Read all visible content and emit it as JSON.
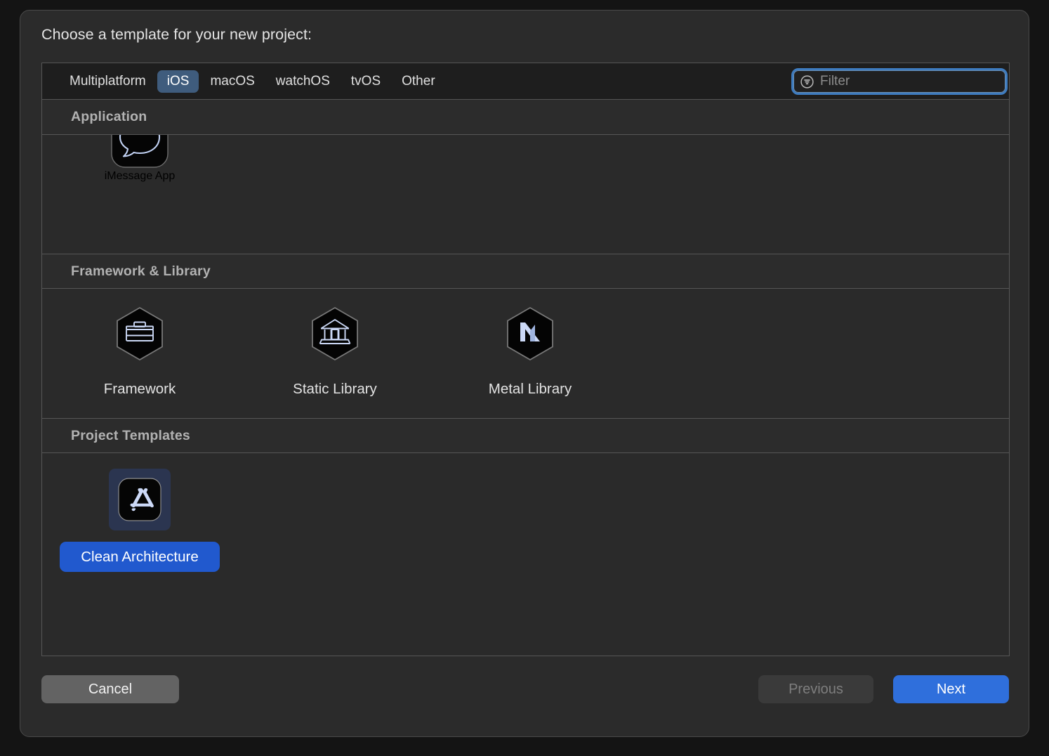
{
  "dialog": {
    "title": "Choose a template for your new project:"
  },
  "tabs": [
    {
      "label": "Multiplatform",
      "selected": false
    },
    {
      "label": "iOS",
      "selected": true
    },
    {
      "label": "macOS",
      "selected": false
    },
    {
      "label": "watchOS",
      "selected": false
    },
    {
      "label": "tvOS",
      "selected": false
    },
    {
      "label": "Other",
      "selected": false
    }
  ],
  "filter": {
    "placeholder": "Filter",
    "value": "",
    "icon": "filter-icon",
    "focused": true
  },
  "sections": [
    {
      "header": "Application",
      "items": [
        {
          "label": "iMessage App",
          "icon": "imessage-app-icon",
          "selected": false,
          "clipped": true
        }
      ]
    },
    {
      "header": "Framework & Library",
      "items": [
        {
          "label": "Framework",
          "icon": "framework-toolbox-icon",
          "selected": false
        },
        {
          "label": "Static Library",
          "icon": "static-library-building-icon",
          "selected": false
        },
        {
          "label": "Metal Library",
          "icon": "metal-library-m-icon",
          "selected": false
        }
      ]
    },
    {
      "header": "Project Templates",
      "items": [
        {
          "label": "Clean Architecture",
          "icon": "app-store-a-icon",
          "selected": true
        }
      ]
    }
  ],
  "footer": {
    "cancel_label": "Cancel",
    "previous_label": "Previous",
    "previous_disabled": true,
    "next_label": "Next"
  },
  "colors": {
    "window_background": "#2b2b2b",
    "panel_background": "#2a2a2a",
    "tabbar_background": "#1e1e1e",
    "tab_selected": "#3f5c7d",
    "accent_blue": "#2f6fdc",
    "selection_label": "#2159ce",
    "selection_icon_background": "#2b3550",
    "focus_ring": "#3e7cc0",
    "icon_glyph": "#ccd9f7",
    "section_header_text": "#b2b2b2"
  }
}
